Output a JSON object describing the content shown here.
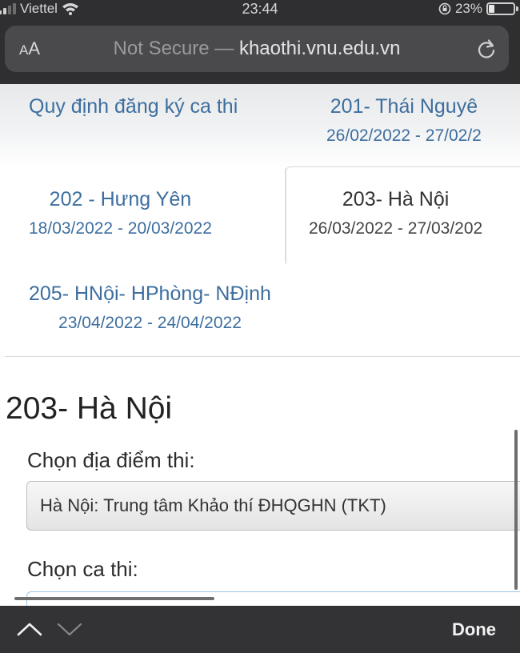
{
  "status_bar": {
    "carrier": "Viettel",
    "time": "23:44",
    "battery": "23%",
    "battery_level": 0.23
  },
  "browser": {
    "aa_small": "A",
    "aa_large": "A",
    "url_prefix": "Not Secure — ",
    "url_domain": "khaothi.vnu.edu.vn"
  },
  "tabs": [
    {
      "title": "Quy định đăng ký ca thi",
      "date": ""
    },
    {
      "title": "201- Thái Nguyê",
      "date": "26/02/2022 - 27/02/2"
    },
    {
      "title": "202 - Hưng Yên",
      "date": "18/03/2022 - 20/03/2022"
    },
    {
      "title": "203- Hà Nội",
      "date": "26/03/2022 - 27/03/202"
    },
    {
      "title": "205- HNội- HPhòng- NĐịnh",
      "date": "23/04/2022 - 24/04/2022"
    }
  ],
  "section": {
    "title": "203- Hà Nội",
    "location_label": "Chọn địa điểm thi:",
    "location_value": "Hà Nội: Trung tâm Khảo thí ĐHQGHN (TKT)",
    "session_label": "Chọn ca thi:"
  },
  "accessory": {
    "done_label": "Done"
  },
  "colors": {
    "link": "#3d6e9f",
    "chrome": "#2f2f31"
  }
}
